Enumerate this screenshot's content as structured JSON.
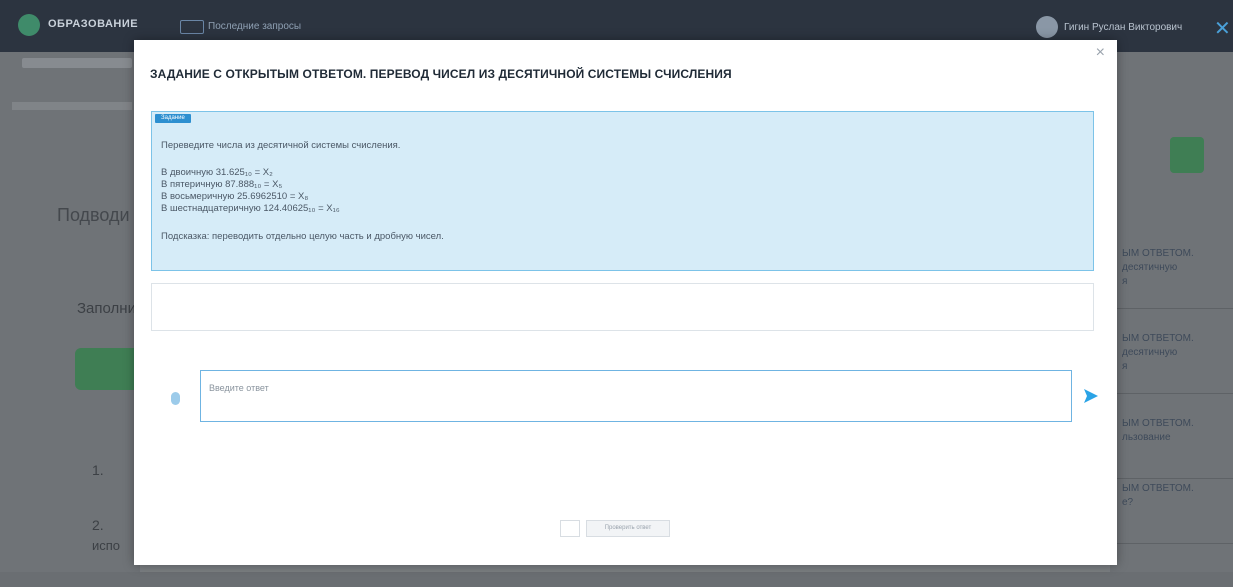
{
  "app": {
    "logo_text": "ОБРАЗОВАНИЕ",
    "nav_link": "Последние запросы",
    "user_name": "Гигин Руслан Викторович",
    "close_icon": "close-icon"
  },
  "background": {
    "heading": "Подводи",
    "fill_text": "Заполни",
    "item1": "1.",
    "item2": "2.",
    "item2_suffix": "испо",
    "right_cards": [
      {
        "line1": "ЫМ ОТВЕТОМ.",
        "line2": "десятичную",
        "line3": "я"
      },
      {
        "line1": "ЫМ ОТВЕТОМ.",
        "line2": "десятичную",
        "line3": "я"
      },
      {
        "line1": "ЫМ ОТВЕТОМ.",
        "line2": "льзование",
        "line3": ""
      },
      {
        "line1": "ЫМ ОТВЕТОМ.",
        "line2": "е?",
        "line3": ""
      }
    ]
  },
  "modal": {
    "title": "ЗАДАНИЕ С ОТКРЫТЫМ ОТВЕТОМ. ПЕРЕВОД ЧИСЕЛ ИЗ ДЕСЯТИЧНОЙ СИСТЕМЫ СЧИСЛЕНИЯ",
    "close_label": "×",
    "task": {
      "tag": "Задание",
      "intro": "Переведите числа из десятичной системы счисления.",
      "lines": [
        "В двоичную 31.625₁₀ = X₂",
        "В пятеричную 87.888₁₀ = X₅",
        "В восьмеричную 25.6962510 = X₈",
        "В шестнадцатеричную 124.40625₁₀ = X₁₆"
      ],
      "hint": "Подсказка: переводить отдельно целую часть и дробную чисел."
    },
    "input_placeholder": "Введите ответ",
    "footer_button": "Проверить ответ"
  }
}
